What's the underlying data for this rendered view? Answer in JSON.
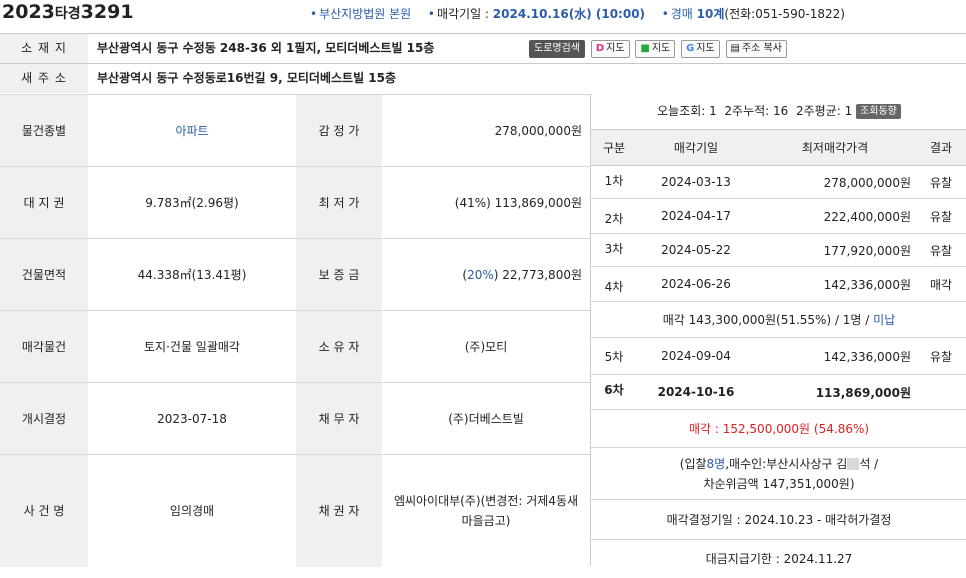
{
  "header": {
    "case_year": "2023",
    "case_type": "타경",
    "case_number": "3291",
    "court": "부산지방법원 본원",
    "sale_date_label": "매각기일 : ",
    "sale_date": "2024.10.16(水) (10:00)",
    "dept_prefix": "경매 ",
    "dept": "10계",
    "phone": "(전화:051-590-1822)"
  },
  "address": {
    "label": "소 재 지",
    "value": "부산광역시 동구 수정동 248-36 외 1필지, 모티더베스트빌 15층",
    "buttons": {
      "road_search": "도로명검색",
      "daum_map": "지도",
      "naver_map": "지도",
      "google_map": "지도",
      "copy": "주소 복사"
    },
    "new_label": "새 주 소",
    "new_value": "부산광역시 동구 수정동로16번길 9, 모티더베스트빌 15층"
  },
  "info": [
    {
      "l1": "물건종별",
      "v1": "아파트",
      "l2": "감 정 가",
      "v2": "278,000,000원"
    },
    {
      "l1": "대 지 권",
      "v1": "9.783㎡(2.96평)",
      "l2": "최 저 가",
      "v2": "(41%) 113,869,000원"
    },
    {
      "l1": "건물면적",
      "v1": "44.338㎡(13.41평)",
      "l2": "보 증 금",
      "v2_pct": "20%",
      "v2": "22,773,800원"
    },
    {
      "l1": "매각물건",
      "v1": "토지·건물 일괄매각",
      "l2": "소 유 자",
      "v2": "(주)모티"
    },
    {
      "l1": "개시결정",
      "v1": "2023-07-18",
      "l2": "채 무 자",
      "v2": "(주)더베스트빌"
    },
    {
      "l1": "사 건 명",
      "v1": "임의경매",
      "l2": "채 권 자",
      "v2": "엠씨아이대부(주)(변경전: 거제4동새마을금고)"
    }
  ],
  "views": {
    "today_label": "오늘조회: ",
    "today": "1",
    "week2_label": "2주누적: ",
    "week2": "16",
    "avg_label": "2주평균: ",
    "avg": "1",
    "trend_button": "조회동향"
  },
  "auction": {
    "headers": [
      "구분",
      "매각기일",
      "최저매각가격",
      "결과"
    ],
    "rows": [
      {
        "round": "1차",
        "date": "2024-03-13",
        "price": "278,000,000원",
        "result": "유찰"
      },
      {
        "round": "2차",
        "date": "2024-04-17",
        "price": "222,400,000원",
        "result": "유찰"
      },
      {
        "round": "3차",
        "date": "2024-05-22",
        "price": "177,920,000원",
        "result": "유찰"
      },
      {
        "round": "4차",
        "date": "2024-06-26",
        "price": "142,336,000원",
        "result": "매각"
      }
    ],
    "sale4_text": "매각 143,300,000원(51.55%) / 1명 / ",
    "sale4_link": "미납",
    "row5": {
      "round": "5차",
      "date": "2024-09-04",
      "price": "142,336,000원",
      "result": "유찰"
    },
    "row6": {
      "round": "6차",
      "date": "2024-10-16",
      "price": "113,869,000원",
      "result": ""
    },
    "sold_label": "매각 : ",
    "sold_amount": "152,500,000원",
    "sold_pct": "(54.86%)",
    "bid_open": "(입찰",
    "bid_count": "8명",
    "bid_rest": ",매수인:부산시사상구 김",
    "bid_name_end": "석 /",
    "second_bid": "차순위금액 147,351,000원)",
    "decision": "매각결정기일 : 2024.10.23 - 매각허가결정",
    "payment": "대금지급기한 : 2024.11.27"
  }
}
